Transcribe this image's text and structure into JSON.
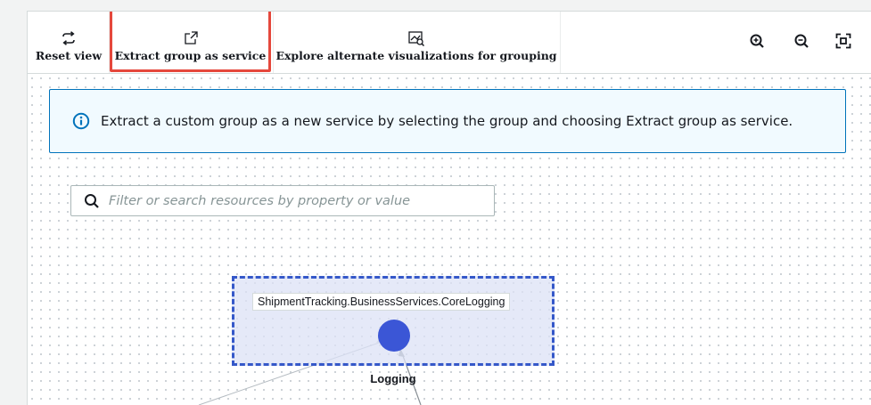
{
  "toolbar": {
    "reset_view_label": "Reset view",
    "extract_label": "Extract group as service",
    "explore_label": "Explore alternate visualizations for grouping"
  },
  "zoom": {
    "in_icon": "zoom-in-icon",
    "out_icon": "zoom-out-icon",
    "fit_icon": "fit-to-screen-icon"
  },
  "info_alert": {
    "text": "Extract a custom group as a new service by selecting the group and choosing Extract group as service."
  },
  "search": {
    "placeholder": "Filter or search resources by property or value"
  },
  "graph": {
    "group_label": "ShipmentTracking.BusinessServices.CoreLogging",
    "group_caption": "Logging"
  },
  "colors": {
    "highlight": "#e5483c",
    "node": "#3b56d6",
    "group_border": "#3558c9",
    "info_border": "#0073bb"
  }
}
